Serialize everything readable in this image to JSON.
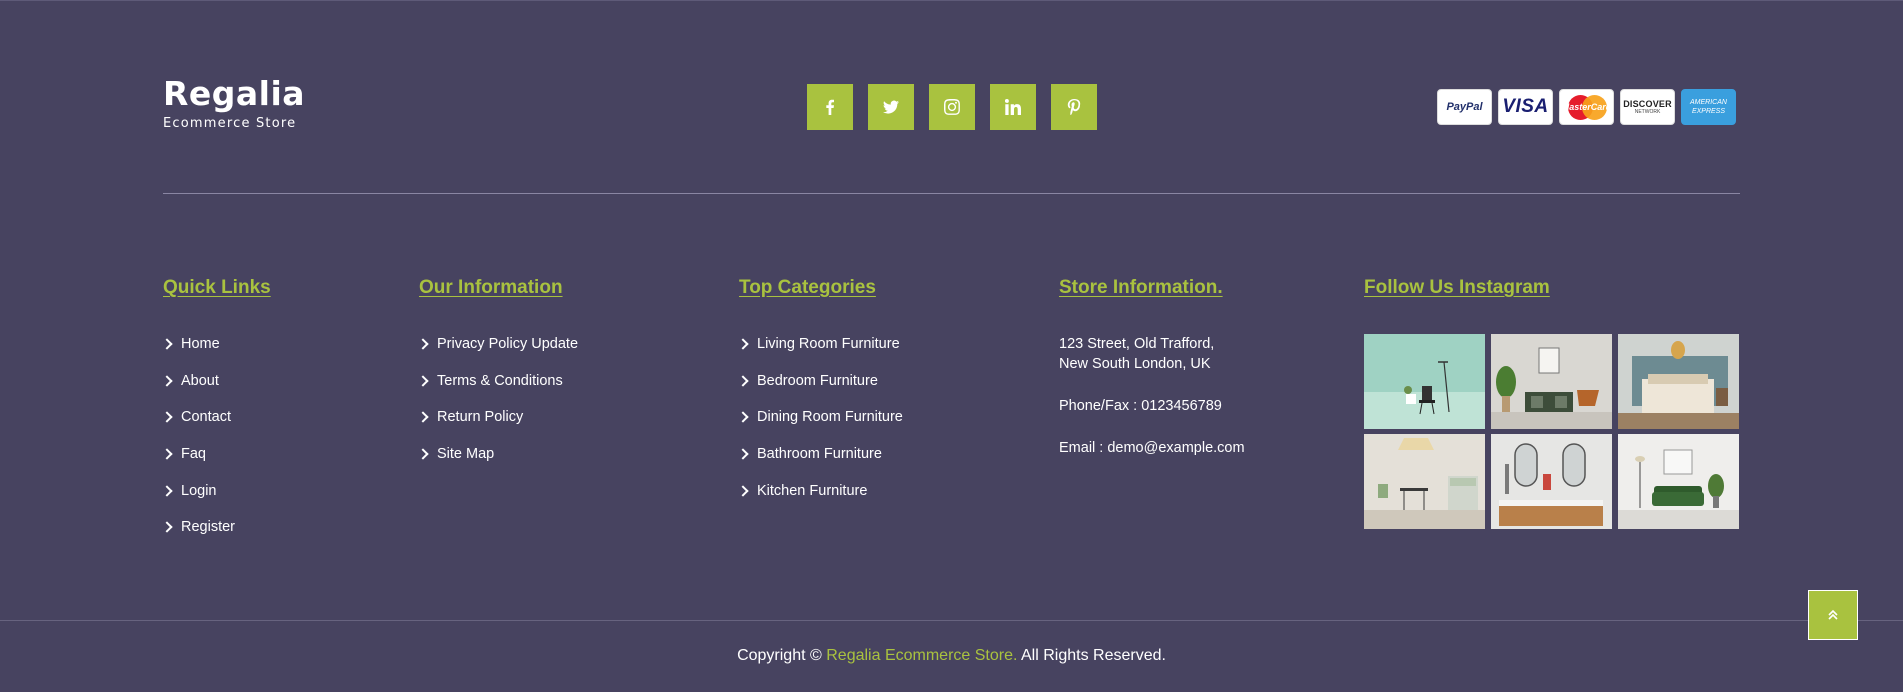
{
  "brand": {
    "name": "Regalia",
    "tagline": "Ecommerce Store"
  },
  "social": [
    {
      "name": "facebook-icon",
      "label": "f"
    },
    {
      "name": "twitter-icon",
      "label": "twitter"
    },
    {
      "name": "instagram-icon",
      "label": "instagram"
    },
    {
      "name": "linkedin-icon",
      "label": "in"
    },
    {
      "name": "pinterest-icon",
      "label": "p"
    }
  ],
  "payments": {
    "paypal": "PayPal",
    "visa": "VISA",
    "mastercard": "MasterCard",
    "discover": "DISCOVER",
    "discover_sub": "NETWORK",
    "amex_1": "AMERICAN",
    "amex_2": "EXPRESS"
  },
  "quick_links": {
    "title": "Quick Links",
    "items": [
      "Home",
      "About",
      "Contact",
      "Faq",
      "Login",
      "Register"
    ]
  },
  "our_information": {
    "title": "Our Information",
    "items": [
      "Privacy Policy Update",
      "Terms & Conditions",
      "Return Policy",
      "Site Map"
    ]
  },
  "top_categories": {
    "title": "Top Categories",
    "items": [
      "Living Room Furniture",
      "Bedroom Furniture",
      "Dining Room Furniture",
      "Bathroom Furniture",
      "Kitchen Furniture"
    ]
  },
  "store_information": {
    "title": "Store Information.",
    "address_1": "123 Street, Old Trafford,",
    "address_2": "New South London, UK",
    "phone": "Phone/Fax : 0123456789",
    "email": "Email : demo@example.com"
  },
  "instagram": {
    "title": "Follow Us Instagram"
  },
  "footer": {
    "copyright_prefix": "Copyright ©",
    "brand_link": "Regalia Ecommerce Store.",
    "suffix": "All Rights Reserved."
  },
  "colors": {
    "background": "#474360",
    "accent": "#a9c23f"
  }
}
